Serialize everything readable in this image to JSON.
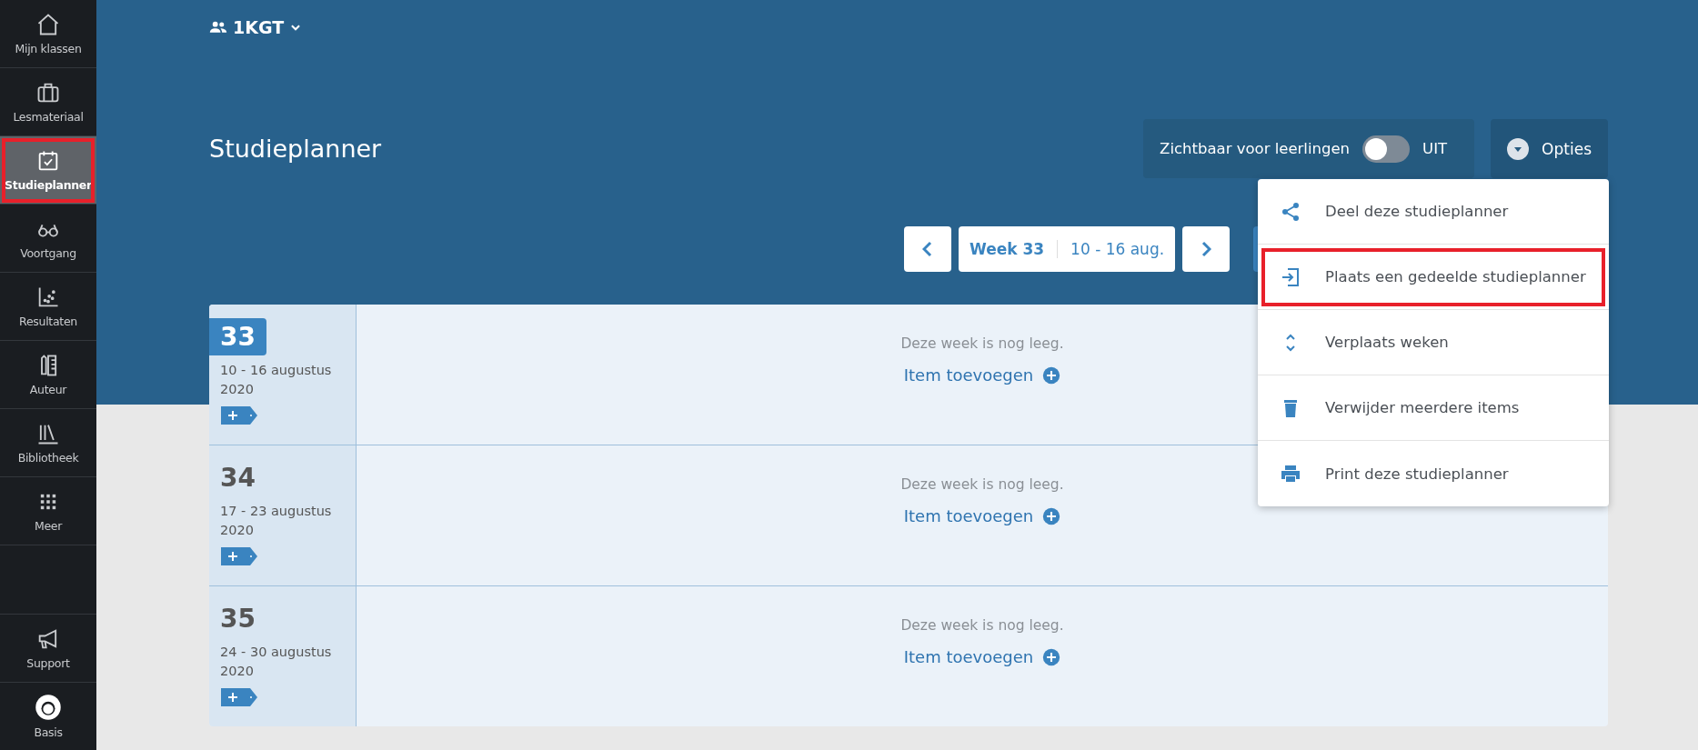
{
  "sidebar": {
    "items": [
      {
        "label": "Mijn klassen",
        "selected": false,
        "highlighted": false
      },
      {
        "label": "Lesmateriaal",
        "selected": false,
        "highlighted": false
      },
      {
        "label": "Studieplanner",
        "selected": true,
        "highlighted": true
      },
      {
        "label": "Voortgang",
        "selected": false,
        "highlighted": false
      },
      {
        "label": "Resultaten",
        "selected": false,
        "highlighted": false
      },
      {
        "label": "Auteur",
        "selected": false,
        "highlighted": false
      },
      {
        "label": "Bibliotheek",
        "selected": false,
        "highlighted": false
      },
      {
        "label": "Meer",
        "selected": false,
        "highlighted": false
      }
    ],
    "bottom_items": [
      {
        "label": "Support"
      },
      {
        "label": "Basis"
      }
    ]
  },
  "class_selector": {
    "label": "1KGT"
  },
  "title": "Studieplanner",
  "visibility": {
    "label": "Zichtbaar voor leerlingen",
    "on": false,
    "state_text": "UIT"
  },
  "options_button": {
    "label": "Opties",
    "expanded": true
  },
  "options_menu": [
    {
      "label": "Deel deze studieplanner",
      "highlighted": false
    },
    {
      "label": "Plaats een gedeelde studieplanner",
      "highlighted": true
    },
    {
      "label": "Verplaats weken",
      "highlighted": false
    },
    {
      "label": "Verwijder meerdere items",
      "highlighted": false
    },
    {
      "label": "Print deze studieplanner",
      "highlighted": false
    }
  ],
  "week_nav": {
    "week": "Week 33",
    "range": "10 - 16 aug."
  },
  "weeks": [
    {
      "number": "33",
      "dates": "10 - 16 augustus 2020",
      "selected": true,
      "empty_text": "Deze week is nog leeg.",
      "add_label": "Item toevoegen"
    },
    {
      "number": "34",
      "dates": "17 - 23 augustus 2020",
      "selected": false,
      "empty_text": "Deze week is nog leeg.",
      "add_label": "Item toevoegen"
    },
    {
      "number": "35",
      "dates": "24 - 30 augustus 2020",
      "selected": false,
      "empty_text": "Deze week is nog leeg.",
      "add_label": "Item toevoegen"
    }
  ]
}
